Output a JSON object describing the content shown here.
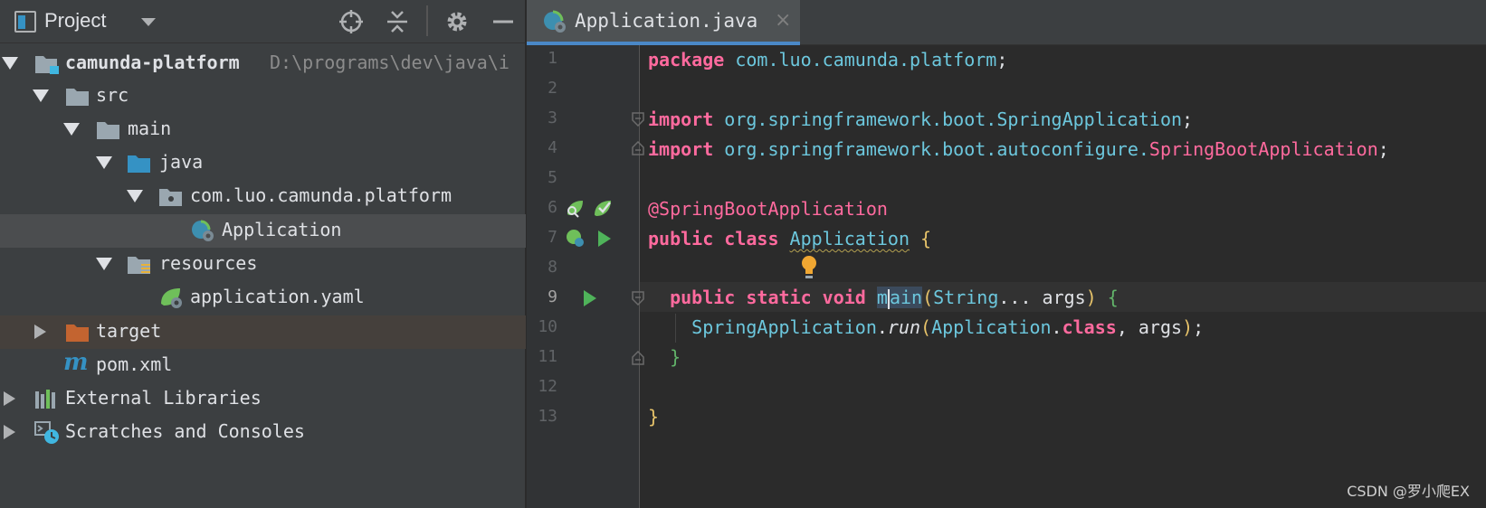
{
  "project_panel": {
    "title": "Project",
    "tree": [
      {
        "label": "camunda-platform",
        "path": "D:\\programs\\dev\\java\\i"
      },
      {
        "label": "src"
      },
      {
        "label": "main"
      },
      {
        "label": "java"
      },
      {
        "label": "com.luo.camunda.platform"
      },
      {
        "label": "Application"
      },
      {
        "label": "resources"
      },
      {
        "label": "application.yaml"
      },
      {
        "label": "target"
      },
      {
        "label": "pom.xml"
      },
      {
        "label": "External Libraries"
      },
      {
        "label": "Scratches and Consoles"
      }
    ]
  },
  "editor": {
    "tab": {
      "label": "Application.java",
      "close": "×"
    },
    "line_numbers": [
      "1",
      "2",
      "3",
      "4",
      "5",
      "6",
      "7",
      "8",
      "9",
      "10",
      "11",
      "12",
      "13"
    ],
    "code": {
      "l1_kw": "package",
      "l1_pkg": "com.luo.camunda.platform",
      "l1_end": ";",
      "l3_kw": "import",
      "l3_pkg": "org.springframework.boot.SpringApplication",
      "l3_end": ";",
      "l4_kw": "import",
      "l4_pkg": "org.springframework.boot.autoconfigure.",
      "l4_cls": "SpringBootApplication",
      "l4_end": ";",
      "l6_ann": "@SpringBootApplication",
      "l7_kw": "public class",
      "l7_cls": "Application",
      "l7_brace": "{",
      "l9_kw": "public static void",
      "l9_m1": "m",
      "l9_m2": "ain",
      "l9_lp": "(",
      "l9_type": "String",
      "l9_rest": "... args",
      "l9_rp": ")",
      "l9_brace": "{",
      "l10_cls": "SpringApplication",
      "l10_dot": ".",
      "l10_run": "run",
      "l10_lp": "(",
      "l10_cls2": "Application",
      "l10_dot2": ".",
      "l10_kw": "class",
      "l10_args": ", args",
      "l10_rp": ")",
      "l10_end": ";",
      "l11_brace": "}",
      "l13_brace": "}"
    }
  },
  "watermark": "CSDN @罗小爬EX",
  "colors": {
    "accent": "#4a88c7",
    "keyword": "#ff6a9e",
    "type": "#6cc7dd",
    "run": "#4fb35a"
  }
}
